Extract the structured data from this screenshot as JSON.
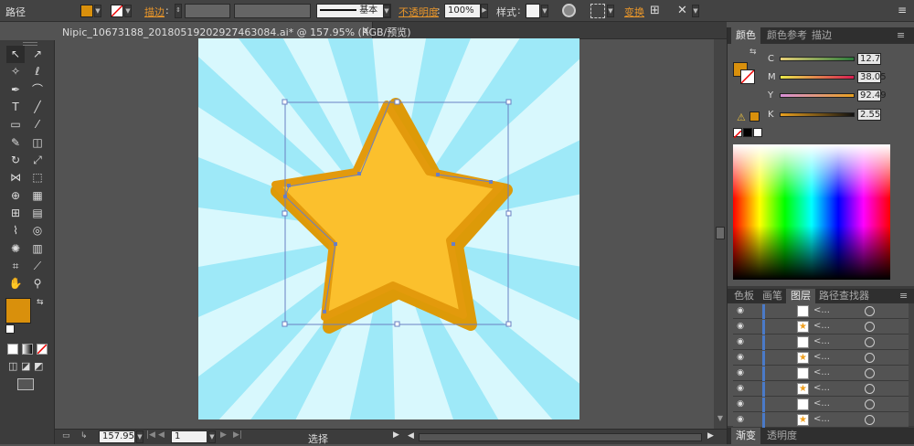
{
  "control_bar": {
    "object_type": "路径",
    "stroke_label": "描边",
    "stroke_profile": "基本",
    "opacity_label": "不透明度",
    "opacity_value": "100%",
    "style_label": "样式",
    "transform_label": "变换"
  },
  "document": {
    "tab_title": "Nipic_10673188_20180519202927463084.ai* @ 157.95% (RGB/预览)",
    "close_icon": "×"
  },
  "panels": {
    "top_tabs": [
      "颜色",
      "颜色参考",
      "描边"
    ],
    "cmyk": [
      {
        "label": "C",
        "value": "12.7"
      },
      {
        "label": "M",
        "value": "38.05"
      },
      {
        "label": "Y",
        "value": "92.49"
      },
      {
        "label": "K",
        "value": "2.55"
      }
    ],
    "bottom_tabs": [
      "色板",
      "画笔",
      "图层",
      "路径查找器"
    ],
    "footer_tabs": [
      "渐变",
      "透明度"
    ],
    "layer_names": [
      "<...",
      "<...",
      "<...",
      "<...",
      "<...",
      "<...",
      "<...",
      "<..."
    ]
  },
  "status_bar": {
    "zoom": "157.95",
    "artboard_number": "1",
    "tool_name": "选择"
  },
  "colors": {
    "fill": "#d9900c",
    "star_fill": "#fbc02d",
    "star_shadow": "#dd9a08",
    "ray_light": "#d8f8fd",
    "ray_dark": "#9ee9f8",
    "selection": "#6a7fc2"
  }
}
